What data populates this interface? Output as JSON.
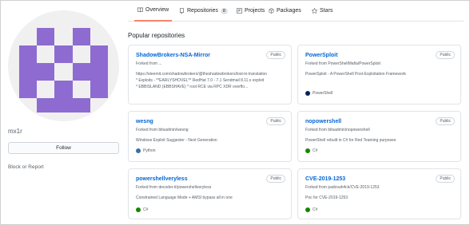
{
  "profile": {
    "username": "mx1r",
    "follow_label": "Follow",
    "block_report_label": "Block or Report",
    "avatar_color": "#8e6bd1"
  },
  "tabs": [
    {
      "label": "Overview",
      "icon": "book-icon",
      "active": true
    },
    {
      "label": "Repositories",
      "icon": "repo-icon",
      "count": "8"
    },
    {
      "label": "Projects",
      "icon": "project-icon"
    },
    {
      "label": "Packages",
      "icon": "package-icon"
    },
    {
      "label": "Stars",
      "icon": "star-icon"
    }
  ],
  "section_title": "Popular repositories",
  "repos": [
    {
      "name": "ShadowBrokers-NSA-Mirror",
      "badge": "Public",
      "forked": "Forked from ...",
      "desc_lines": [
        "https://steemit.com/shadowbrokers/@theshadowbrokers/lost-in-translation",
        "* Exploits - **EARLYSHOVEL** RedHat 7.0 - 7.1 Sendmail 8.11.x exploit",
        "* EBBISLAND (EBBSHAVE) * root RCE via RPC XDR overflo..."
      ]
    },
    {
      "name": "PowerSploit",
      "badge": "Public",
      "forked": "Forked from PowerShellMafia/PowerSploit",
      "desc_lines": [
        "PowerSploit - A PowerShell Post-Exploitation Framework"
      ],
      "language": "PowerShell",
      "lang_color": "#012456"
    },
    {
      "name": "wesng",
      "badge": "Public",
      "forked": "Forked from bitsadmin/wesng",
      "desc_lines": [
        "Windows Exploit Suggester - Next Generation"
      ],
      "language": "Python",
      "lang_color": "#3572a5"
    },
    {
      "name": "nopowershell",
      "badge": "Public",
      "forked": "Forked from bitsadmin/nopowershell",
      "desc_lines": [
        "PowerShell rebuilt in C# for Red Teaming purposes"
      ],
      "language": "C#",
      "lang_color": "#178600"
    },
    {
      "name": "powershellveryless",
      "badge": "Public",
      "forked": "Forked from decoder-it/powershellveryless",
      "desc_lines": [
        "Constrained Language Mode + AMSI bypass all in one"
      ],
      "language": "C#",
      "lang_color": "#178600"
    },
    {
      "name": "CVE-2019-1253",
      "badge": "Public",
      "forked": "Forked from padovah4ck/CVE-2019-1253",
      "desc_lines": [
        "Poc for CVE-2019-1253"
      ],
      "language": "C#",
      "lang_color": "#178600"
    }
  ]
}
